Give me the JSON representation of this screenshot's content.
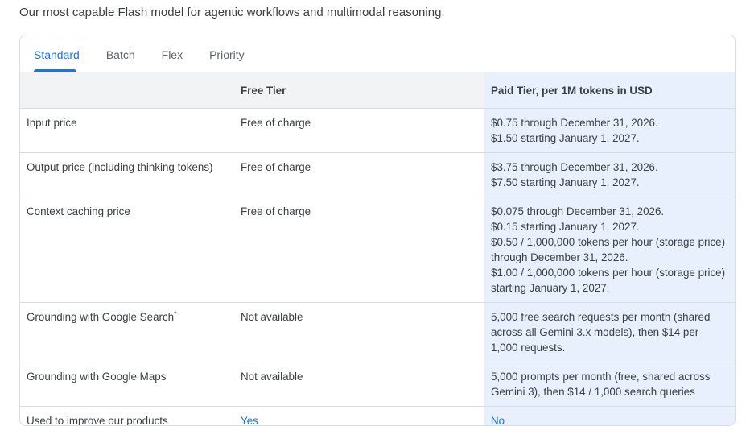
{
  "intro": "Our most capable Flash model for agentic workflows and multimodal reasoning.",
  "tabs": [
    "Standard",
    "Batch",
    "Flex",
    "Priority"
  ],
  "active_tab": "Standard",
  "table": {
    "headers": [
      "",
      "Free Tier",
      "Paid Tier, per 1M tokens in USD"
    ],
    "rows": [
      {
        "label": "Input price",
        "free": "Free of charge",
        "paid": [
          "$0.75 through December 31, 2026.",
          "$1.50 starting January 1, 2027."
        ]
      },
      {
        "label": "Output price (including thinking tokens)",
        "free": "Free of charge",
        "paid": [
          "$3.75 through December 31, 2026.",
          "$7.50 starting January 1, 2027."
        ]
      },
      {
        "label": "Context caching price",
        "free": "Free of charge",
        "paid": [
          "$0.075 through December 31, 2026.",
          "$0.15 starting January 1, 2027.",
          "$0.50 / 1,000,000 tokens per hour (storage price) through December 31, 2026.",
          "$1.00 / 1,000,000 tokens per hour (storage price) starting January 1, 2027."
        ]
      },
      {
        "label": "Grounding with Google Search",
        "label_sup": "*",
        "free": "Not available",
        "paid": [
          "5,000 free search requests per month (shared across all Gemini 3.x models), then $14 per 1,000 requests."
        ]
      },
      {
        "label": "Grounding with Google Maps",
        "free": "Not available",
        "paid": [
          "5,000 prompts per month (free, shared across Gemini 3), then $14 / 1,000 search queries"
        ]
      },
      {
        "label": "Used to improve our products",
        "free": "Yes",
        "paid": [
          "No"
        ]
      }
    ]
  },
  "colors": {
    "accent": "#1a73e8",
    "paid_column_bg": "#e8f0fe",
    "header_bg": "#f1f3f4",
    "border": "#dadce0"
  }
}
